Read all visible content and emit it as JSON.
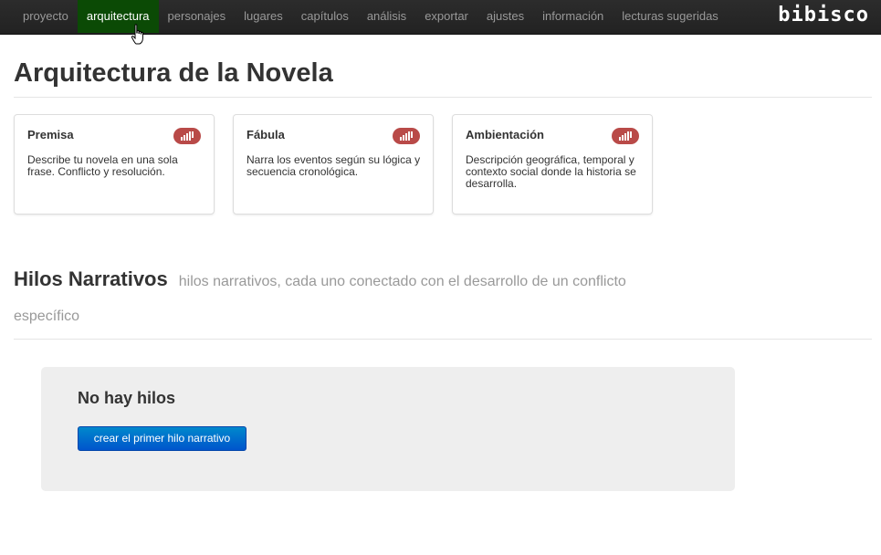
{
  "navbar": {
    "items": [
      {
        "label": "proyecto"
      },
      {
        "label": "arquitectura"
      },
      {
        "label": "personajes"
      },
      {
        "label": "lugares"
      },
      {
        "label": "capítulos"
      },
      {
        "label": "análisis"
      },
      {
        "label": "exportar"
      },
      {
        "label": "ajustes"
      },
      {
        "label": "información"
      },
      {
        "label": "lecturas sugeridas"
      }
    ],
    "active_index": 1,
    "active_color": "#0b4a05",
    "brand": "bibisco"
  },
  "page": {
    "title": "Arquitectura de la Novela"
  },
  "cards": [
    {
      "title": "Premisa",
      "description": "Describe tu novela en una sola frase. Conflicto y resolución.",
      "badge_icon": "status-bars-icon"
    },
    {
      "title": "Fábula",
      "description": "Narra los eventos según su lógica y secuencia cronológica.",
      "badge_icon": "status-bars-icon"
    },
    {
      "title": "Ambientación",
      "description": "Descripción geográfica, temporal y contexto social donde la historia se desarrolla.",
      "badge_icon": "status-bars-icon"
    }
  ],
  "colors": {
    "badge": "#b94a48",
    "primary_button": "#0066cc"
  },
  "narrative_threads": {
    "title": "Hilos Narrativos",
    "subtitle": "hilos narrativos, cada uno conectado con el desarrollo de un conflicto específico",
    "empty_title": "No hay hilos",
    "create_button_label": "crear el primer hilo narrativo"
  }
}
